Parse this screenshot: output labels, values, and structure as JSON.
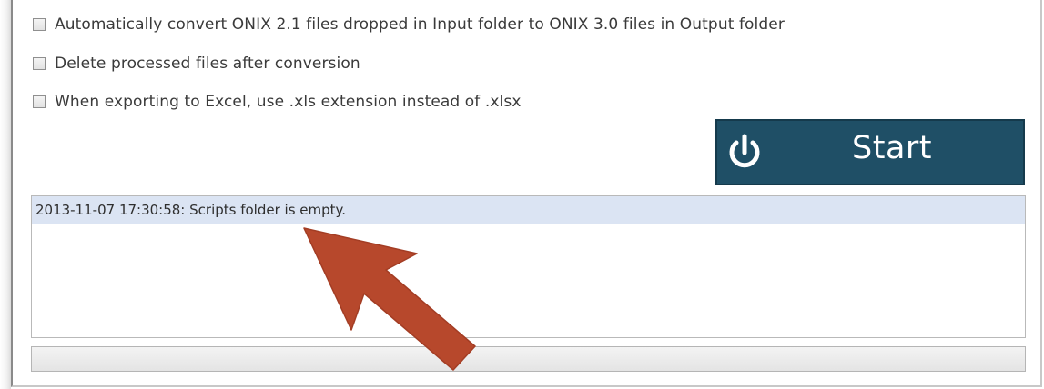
{
  "options": [
    {
      "label": "Automatically convert ONIX 2.1 files dropped in Input folder to ONIX 3.0 files in Output folder",
      "checked": false
    },
    {
      "label": "Delete processed files after conversion",
      "checked": false
    },
    {
      "label": "When exporting to Excel, use .xls extension instead of .xlsx",
      "checked": false
    }
  ],
  "start_button": {
    "label": "Start",
    "icon": "power-icon",
    "background_color": "#1f4f66",
    "text_color": "#ffffff"
  },
  "log": {
    "lines": [
      "2013-11-07 17:30:58: Scripts folder is empty."
    ],
    "highlight_color": "#dbe4f3"
  },
  "progress": {
    "value": 0
  },
  "annotation": {
    "icon": "red-arrow-icon",
    "color": "#b7482c"
  }
}
